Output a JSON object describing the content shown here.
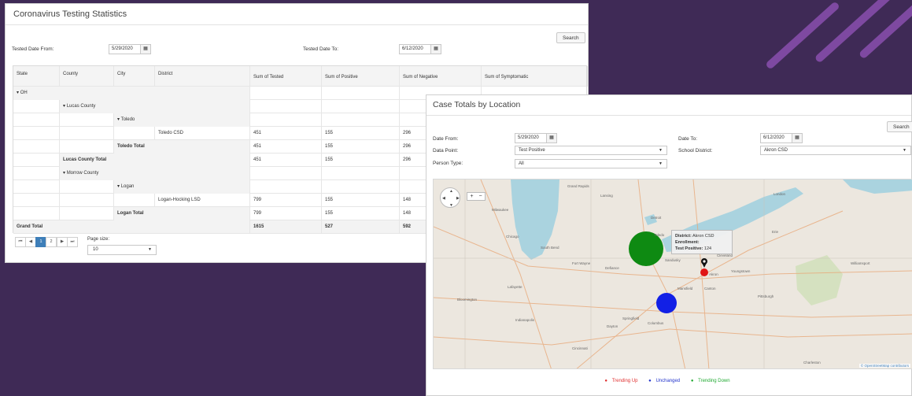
{
  "colors": {
    "background": "#3f2a56",
    "stripe": "#8a4fae",
    "pager_active": "#3e7fb9",
    "bubble_green": "#0e8a12",
    "bubble_blue": "#1220e6",
    "marker_red": "#e01515",
    "trend_up": "#e03030",
    "unchanged": "#2233cc",
    "trend_down": "#22aa33",
    "lake": "#aad3df"
  },
  "testing": {
    "title": "Coronavirus Testing Statistics",
    "search_label": "Search",
    "date_from_label": "Tested Date From:",
    "date_from_value": "5/29/2020",
    "date_to_label": "Tested Date To:",
    "date_to_value": "6/12/2020",
    "calendar_icon": "calendar-icon",
    "headers": {
      "state": "State",
      "county": "County",
      "city": "City",
      "district": "District",
      "tested": "Sum of Tested",
      "positive": "Sum of Positive",
      "negative": "Sum of Negative",
      "symptomatic": "Sum of Symptomatic"
    },
    "rows": {
      "oh": "OH",
      "lucas": "Lucas County",
      "toledo": "Toledo",
      "toledo_csd": "Toledo CSD",
      "toledo_csd_tested": "451",
      "toledo_csd_positive": "155",
      "toledo_csd_negative": "296",
      "toledo_total": "Toledo Total",
      "toledo_total_tested": "451",
      "toledo_total_positive": "155",
      "toledo_total_negative": "296",
      "lucas_total": "Lucas County Total",
      "lucas_total_tested": "451",
      "lucas_total_positive": "155",
      "lucas_total_negative": "296",
      "morrow": "Morrow County",
      "logan": "Logan",
      "logan_hocking": "Logan-Hocking LSD",
      "logan_hocking_tested": "799",
      "logan_hocking_positive": "155",
      "logan_hocking_negative": "148",
      "logan_total": "Logan Total",
      "logan_total_tested": "799",
      "logan_total_positive": "155",
      "logan_total_negative": "148",
      "grand_total": "Grand Total",
      "grand_tested": "1615",
      "grand_positive": "527",
      "grand_negative": "592"
    },
    "pager": {
      "first": "⏮",
      "prev": "◀",
      "page1": "1",
      "page2": "2",
      "next": "▶",
      "last": "⏭",
      "size_label": "Page size:",
      "size_value": "10"
    }
  },
  "cases": {
    "title": "Case Totals by Location",
    "search_label": "Search",
    "date_from_label": "Date From:",
    "date_from_value": "5/29/2020",
    "date_to_label": "Date To:",
    "date_to_value": "6/12/2020",
    "data_point_label": "Data Point:",
    "data_point_value": "Test Positive",
    "school_district_label": "School District:",
    "school_district_value": "Akron CSD",
    "person_type_label": "Person Type:",
    "person_type_value": "All",
    "map": {
      "zoom_in": "+",
      "zoom_out": "−",
      "attribution": "© OpenStreetMap contributors",
      "tooltip": {
        "district_label": "District:",
        "district_value": "Akron CSD",
        "enrollment_label": "Enrollment:",
        "enrollment_value": "",
        "positive_label": "Test Positive:",
        "positive_value": "124"
      },
      "labels": {
        "milwaukee": "Milwaukee",
        "chicago": "Chicago",
        "detroit": "Detroit",
        "toledo": "Toledo",
        "cleveland": "Cleveland",
        "akron": "Akron",
        "canton": "Canton",
        "columbus": "Columbus",
        "mansfield": "Mansfield",
        "pittsburgh": "Pittsburgh",
        "indianapolis": "Indianapolis",
        "cincinnati": "Cincinnati",
        "dayton": "Dayton",
        "erie": "Erie",
        "london": "London",
        "fort_wayne": "Fort Wayne",
        "lansing": "Lansing",
        "south_bend": "South Bend",
        "lafayette": "Lafayette",
        "grand_rapids": "Grand Rapids",
        "springfield": "Springfield",
        "defiance": "Defiance",
        "williamsport": "Williamsport",
        "bloomington": "Bloomington",
        "sandusky": "Sandusky",
        "youngstown": "Youngstown",
        "charleston": "Charleston"
      }
    },
    "legend": {
      "up": "Trending Up",
      "unchanged": "Unchanged",
      "down": "Trending Down"
    }
  }
}
